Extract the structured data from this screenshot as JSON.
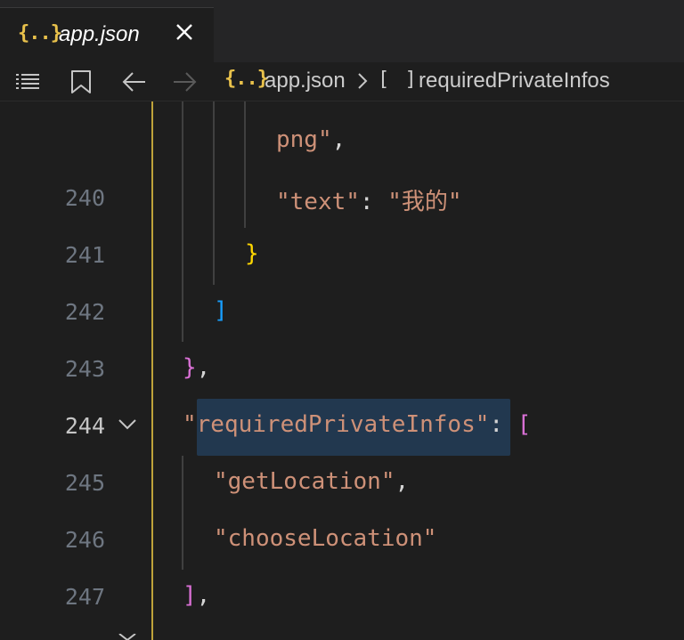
{
  "tab": {
    "icon": "json-braces-icon",
    "icon_text": "{..}",
    "label": "app.json",
    "close": "close-icon"
  },
  "breadcrumb": {
    "tools": [
      "list-icon",
      "bookmark-icon",
      "arrow-left-icon",
      "arrow-right-icon"
    ],
    "file_icon_text": "{..}",
    "file": "app.json",
    "separator": "chevron-right-icon",
    "array_icon_text": "[ ]",
    "key": "requiredPrivateInfos"
  },
  "editor": {
    "lines": [
      {
        "num": "",
        "tokens": [
          {
            "t": "png",
            "c": "str"
          },
          {
            "t": "\"",
            "c": "str"
          },
          {
            "t": ",",
            "c": "punc"
          }
        ]
      },
      {
        "num": "240",
        "tokens": [
          {
            "t": "\"text\"",
            "c": "str"
          },
          {
            "t": ": ",
            "c": "punc"
          },
          {
            "t": "\"我的\"",
            "c": "str"
          }
        ]
      },
      {
        "num": "241",
        "tokens": [
          {
            "t": "}",
            "c": "b-yellow"
          }
        ]
      },
      {
        "num": "242",
        "tokens": [
          {
            "t": "]",
            "c": "b-blue"
          }
        ]
      },
      {
        "num": "243",
        "tokens": [
          {
            "t": "}",
            "c": "b-purple"
          },
          {
            "t": ",",
            "c": "punc"
          }
        ]
      },
      {
        "num": "244",
        "tokens": [
          {
            "t": "\"requiredPrivateInfos\"",
            "c": "str"
          },
          {
            "t": ": ",
            "c": "punc"
          },
          {
            "t": "[",
            "c": "b-purple"
          }
        ]
      },
      {
        "num": "245",
        "tokens": [
          {
            "t": "\"getLocation\"",
            "c": "str"
          },
          {
            "t": ",",
            "c": "punc"
          }
        ]
      },
      {
        "num": "246",
        "tokens": [
          {
            "t": "\"chooseLocation\"",
            "c": "str"
          }
        ]
      },
      {
        "num": "247",
        "tokens": [
          {
            "t": "]",
            "c": "b-purple"
          },
          {
            "t": ",",
            "c": "punc"
          }
        ]
      }
    ],
    "active_line": "244"
  },
  "colors": {
    "background": "#1e1e1e",
    "string": "#ce9178",
    "bracket_yellow": "#ffd700",
    "bracket_purple": "#da70d6",
    "bracket_blue": "#179fff",
    "json_icon": "#e8c14b",
    "selection": "#264f78"
  }
}
